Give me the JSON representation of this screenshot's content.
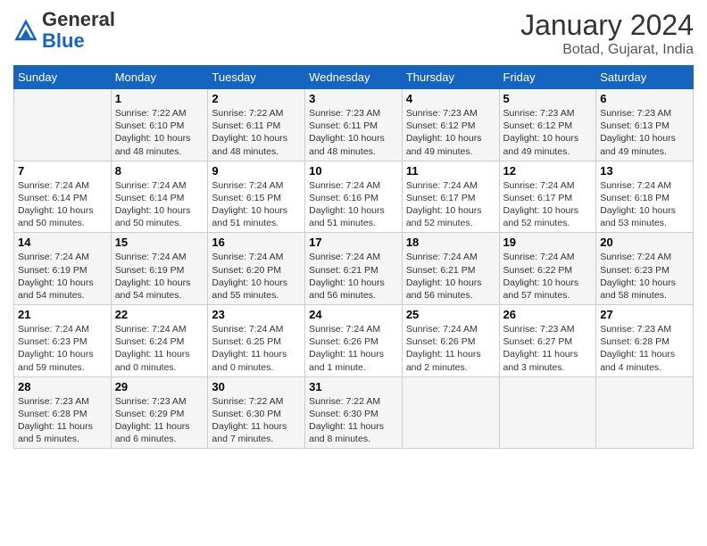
{
  "header": {
    "logo_general": "General",
    "logo_blue": "Blue",
    "month_title": "January 2024",
    "location": "Botad, Gujarat, India"
  },
  "days_of_week": [
    "Sunday",
    "Monday",
    "Tuesday",
    "Wednesday",
    "Thursday",
    "Friday",
    "Saturday"
  ],
  "weeks": [
    [
      {
        "day": "",
        "info": ""
      },
      {
        "day": "1",
        "info": "Sunrise: 7:22 AM\nSunset: 6:10 PM\nDaylight: 10 hours\nand 48 minutes."
      },
      {
        "day": "2",
        "info": "Sunrise: 7:22 AM\nSunset: 6:11 PM\nDaylight: 10 hours\nand 48 minutes."
      },
      {
        "day": "3",
        "info": "Sunrise: 7:23 AM\nSunset: 6:11 PM\nDaylight: 10 hours\nand 48 minutes."
      },
      {
        "day": "4",
        "info": "Sunrise: 7:23 AM\nSunset: 6:12 PM\nDaylight: 10 hours\nand 49 minutes."
      },
      {
        "day": "5",
        "info": "Sunrise: 7:23 AM\nSunset: 6:12 PM\nDaylight: 10 hours\nand 49 minutes."
      },
      {
        "day": "6",
        "info": "Sunrise: 7:23 AM\nSunset: 6:13 PM\nDaylight: 10 hours\nand 49 minutes."
      }
    ],
    [
      {
        "day": "7",
        "info": "Sunrise: 7:24 AM\nSunset: 6:14 PM\nDaylight: 10 hours\nand 50 minutes."
      },
      {
        "day": "8",
        "info": "Sunrise: 7:24 AM\nSunset: 6:14 PM\nDaylight: 10 hours\nand 50 minutes."
      },
      {
        "day": "9",
        "info": "Sunrise: 7:24 AM\nSunset: 6:15 PM\nDaylight: 10 hours\nand 51 minutes."
      },
      {
        "day": "10",
        "info": "Sunrise: 7:24 AM\nSunset: 6:16 PM\nDaylight: 10 hours\nand 51 minutes."
      },
      {
        "day": "11",
        "info": "Sunrise: 7:24 AM\nSunset: 6:17 PM\nDaylight: 10 hours\nand 52 minutes."
      },
      {
        "day": "12",
        "info": "Sunrise: 7:24 AM\nSunset: 6:17 PM\nDaylight: 10 hours\nand 52 minutes."
      },
      {
        "day": "13",
        "info": "Sunrise: 7:24 AM\nSunset: 6:18 PM\nDaylight: 10 hours\nand 53 minutes."
      }
    ],
    [
      {
        "day": "14",
        "info": "Sunrise: 7:24 AM\nSunset: 6:19 PM\nDaylight: 10 hours\nand 54 minutes."
      },
      {
        "day": "15",
        "info": "Sunrise: 7:24 AM\nSunset: 6:19 PM\nDaylight: 10 hours\nand 54 minutes."
      },
      {
        "day": "16",
        "info": "Sunrise: 7:24 AM\nSunset: 6:20 PM\nDaylight: 10 hours\nand 55 minutes."
      },
      {
        "day": "17",
        "info": "Sunrise: 7:24 AM\nSunset: 6:21 PM\nDaylight: 10 hours\nand 56 minutes."
      },
      {
        "day": "18",
        "info": "Sunrise: 7:24 AM\nSunset: 6:21 PM\nDaylight: 10 hours\nand 56 minutes."
      },
      {
        "day": "19",
        "info": "Sunrise: 7:24 AM\nSunset: 6:22 PM\nDaylight: 10 hours\nand 57 minutes."
      },
      {
        "day": "20",
        "info": "Sunrise: 7:24 AM\nSunset: 6:23 PM\nDaylight: 10 hours\nand 58 minutes."
      }
    ],
    [
      {
        "day": "21",
        "info": "Sunrise: 7:24 AM\nSunset: 6:23 PM\nDaylight: 10 hours\nand 59 minutes."
      },
      {
        "day": "22",
        "info": "Sunrise: 7:24 AM\nSunset: 6:24 PM\nDaylight: 11 hours\nand 0 minutes."
      },
      {
        "day": "23",
        "info": "Sunrise: 7:24 AM\nSunset: 6:25 PM\nDaylight: 11 hours\nand 0 minutes."
      },
      {
        "day": "24",
        "info": "Sunrise: 7:24 AM\nSunset: 6:26 PM\nDaylight: 11 hours\nand 1 minute."
      },
      {
        "day": "25",
        "info": "Sunrise: 7:24 AM\nSunset: 6:26 PM\nDaylight: 11 hours\nand 2 minutes."
      },
      {
        "day": "26",
        "info": "Sunrise: 7:23 AM\nSunset: 6:27 PM\nDaylight: 11 hours\nand 3 minutes."
      },
      {
        "day": "27",
        "info": "Sunrise: 7:23 AM\nSunset: 6:28 PM\nDaylight: 11 hours\nand 4 minutes."
      }
    ],
    [
      {
        "day": "28",
        "info": "Sunrise: 7:23 AM\nSunset: 6:28 PM\nDaylight: 11 hours\nand 5 minutes."
      },
      {
        "day": "29",
        "info": "Sunrise: 7:23 AM\nSunset: 6:29 PM\nDaylight: 11 hours\nand 6 minutes."
      },
      {
        "day": "30",
        "info": "Sunrise: 7:22 AM\nSunset: 6:30 PM\nDaylight: 11 hours\nand 7 minutes."
      },
      {
        "day": "31",
        "info": "Sunrise: 7:22 AM\nSunset: 6:30 PM\nDaylight: 11 hours\nand 8 minutes."
      },
      {
        "day": "",
        "info": ""
      },
      {
        "day": "",
        "info": ""
      },
      {
        "day": "",
        "info": ""
      }
    ]
  ]
}
